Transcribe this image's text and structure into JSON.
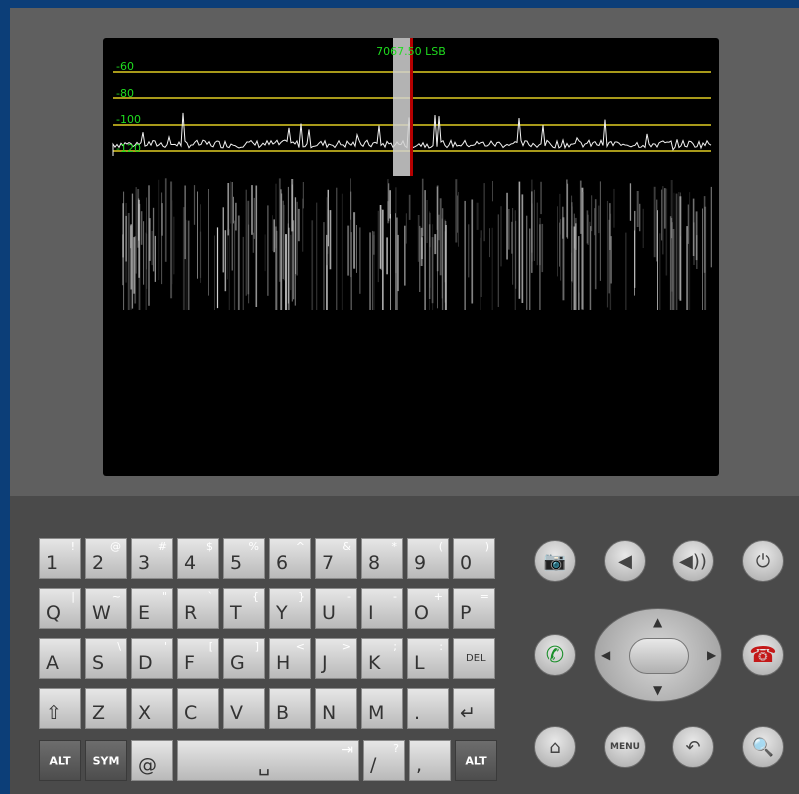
{
  "screen": {
    "frequency_label": "7067.50 LSB",
    "db_labels": [
      "-60",
      "-80",
      "-100",
      "-120"
    ]
  },
  "keyboard": {
    "rows": [
      [
        {
          "main": "1",
          "alt": "!"
        },
        {
          "main": "2",
          "alt": "@"
        },
        {
          "main": "3",
          "alt": "#"
        },
        {
          "main": "4",
          "alt": "$"
        },
        {
          "main": "5",
          "alt": "%"
        },
        {
          "main": "6",
          "alt": "^"
        },
        {
          "main": "7",
          "alt": "&"
        },
        {
          "main": "8",
          "alt": "*"
        },
        {
          "main": "9",
          "alt": "("
        },
        {
          "main": "0",
          "alt": ")"
        }
      ],
      [
        {
          "main": "Q",
          "alt": "|"
        },
        {
          "main": "W",
          "alt": "~"
        },
        {
          "main": "E",
          "alt": "\""
        },
        {
          "main": "R",
          "alt": "`"
        },
        {
          "main": "T",
          "alt": "{"
        },
        {
          "main": "Y",
          "alt": "}"
        },
        {
          "main": "U",
          "alt": "-"
        },
        {
          "main": "I",
          "alt": "-"
        },
        {
          "main": "O",
          "alt": "+"
        },
        {
          "main": "P",
          "alt": "="
        }
      ],
      [
        {
          "main": "A",
          "alt": ""
        },
        {
          "main": "S",
          "alt": "\\"
        },
        {
          "main": "D",
          "alt": "'"
        },
        {
          "main": "F",
          "alt": "["
        },
        {
          "main": "G",
          "alt": "]"
        },
        {
          "main": "H",
          "alt": "<"
        },
        {
          "main": "J",
          "alt": ">"
        },
        {
          "main": "K",
          "alt": ";"
        },
        {
          "main": "L",
          "alt": ":"
        },
        {
          "main": "DEL",
          "alt": ""
        }
      ],
      [
        {
          "main": "⇧",
          "alt": ""
        },
        {
          "main": "Z",
          "alt": ""
        },
        {
          "main": "X",
          "alt": ""
        },
        {
          "main": "C",
          "alt": ""
        },
        {
          "main": "V",
          "alt": ""
        },
        {
          "main": "B",
          "alt": ""
        },
        {
          "main": "N",
          "alt": ""
        },
        {
          "main": "M",
          "alt": ""
        },
        {
          "main": ".",
          "alt": ""
        },
        {
          "main": "↵",
          "alt": ""
        }
      ]
    ],
    "bottom_row": {
      "alt_left": "ALT",
      "sym": "SYM",
      "at": "@",
      "space": "␣",
      "tab": "⇥",
      "slash": "/",
      "slash_alt": "?",
      "comma": ",",
      "alt_right": "ALT"
    }
  },
  "controls": {
    "menu_label": "MENU",
    "icons": [
      "camera-icon",
      "volume-down-icon",
      "volume-up-icon",
      "power-icon",
      "call-icon",
      "end-call-icon",
      "home-icon",
      "menu-icon",
      "back-icon",
      "search-icon"
    ]
  }
}
